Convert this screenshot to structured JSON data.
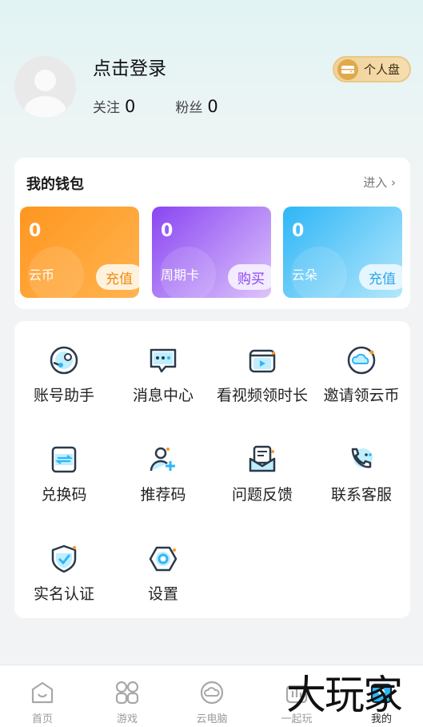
{
  "profile": {
    "login_text": "点击登录",
    "follow_label": "关注",
    "follow_count": "0",
    "fans_label": "粉丝",
    "fans_count": "0",
    "personal_disk_label": "个人盘"
  },
  "wallet": {
    "title": "我的钱包",
    "enter_label": "进入 ›",
    "cards": [
      {
        "amount": "0",
        "name": "云币",
        "action": "充值"
      },
      {
        "amount": "0",
        "name": "周期卡",
        "action": "购买"
      },
      {
        "amount": "0",
        "name": "云朵",
        "action": "充值"
      }
    ]
  },
  "menu": {
    "items": [
      {
        "label": "账号助手",
        "icon": "steam-icon"
      },
      {
        "label": "消息中心",
        "icon": "message-icon"
      },
      {
        "label": "看视频领时长",
        "icon": "video-icon"
      },
      {
        "label": "邀请领云币",
        "icon": "cloud-icon"
      },
      {
        "label": "兑换码",
        "icon": "exchange-icon"
      },
      {
        "label": "推荐码",
        "icon": "add-user-icon"
      },
      {
        "label": "问题反馈",
        "icon": "feedback-icon"
      },
      {
        "label": "联系客服",
        "icon": "phone-icon"
      },
      {
        "label": "实名认证",
        "icon": "shield-check-icon"
      },
      {
        "label": "设置",
        "icon": "settings-icon"
      }
    ]
  },
  "tabbar": {
    "tabs": [
      {
        "label": "首页",
        "icon": "home-icon"
      },
      {
        "label": "游戏",
        "icon": "games-icon"
      },
      {
        "label": "云电脑",
        "icon": "cloud-pc-icon"
      },
      {
        "label": "一起玩",
        "icon": "play-together-icon"
      },
      {
        "label": "我的",
        "icon": "profile-icon"
      }
    ]
  },
  "watermark": "大玩家",
  "colors": {
    "accent_blue": "#2eb6f7",
    "orange": "#ff9620",
    "purple": "#8a45f2",
    "gold": "#e0a94a"
  }
}
